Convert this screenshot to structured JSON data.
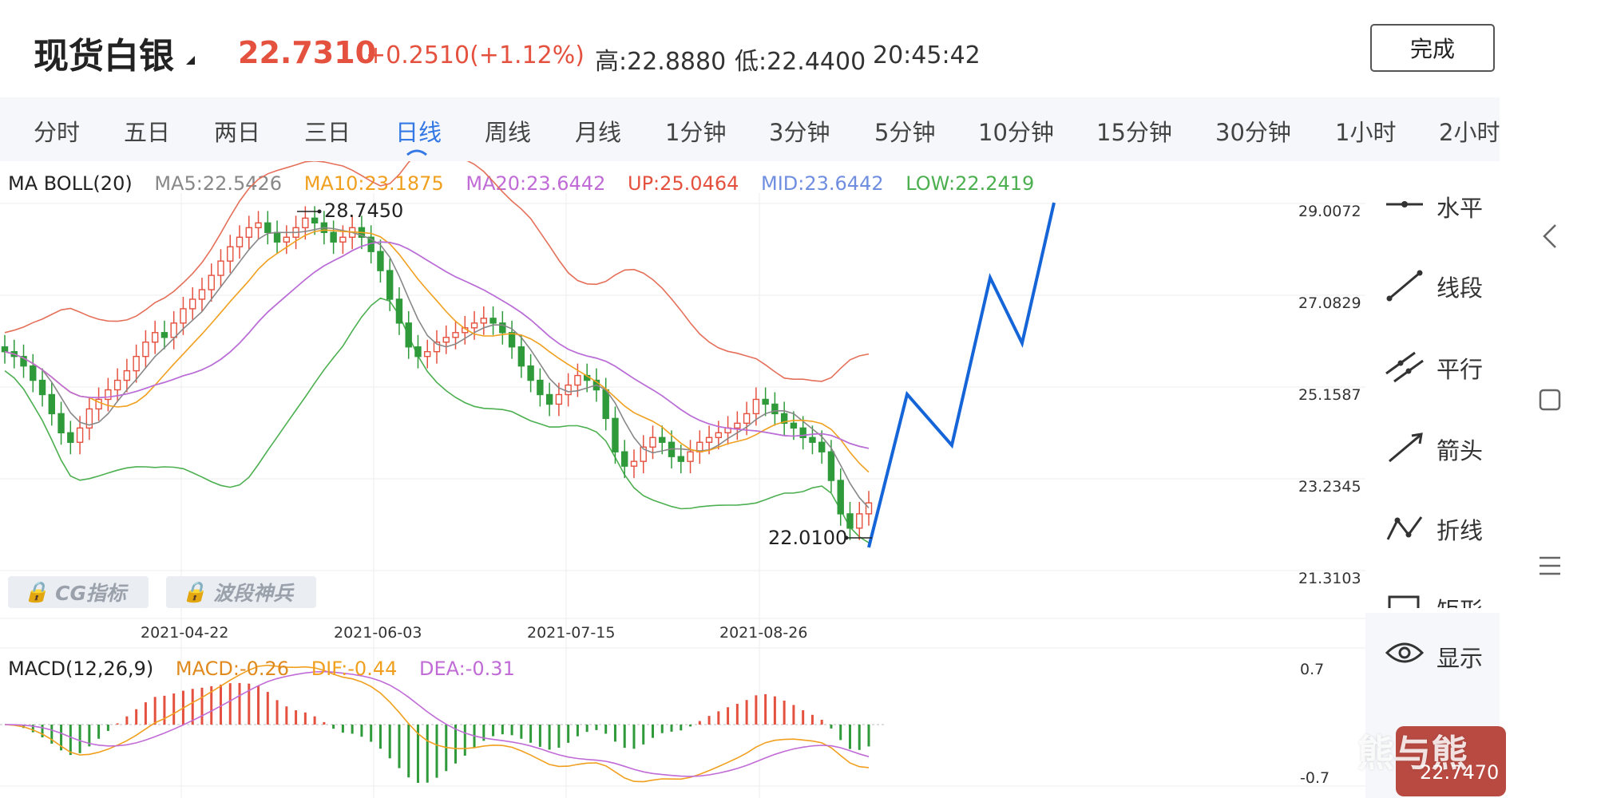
{
  "header": {
    "title": "现货白银",
    "price": "22.7310",
    "change": "+0.2510(+1.12%)",
    "high": "高:22.8880",
    "low": "低:22.4400",
    "time": "20:45:42",
    "done_label": "完成"
  },
  "tabs": [
    {
      "label": "分时"
    },
    {
      "label": "五日"
    },
    {
      "label": "两日"
    },
    {
      "label": "三日"
    },
    {
      "label": "日线",
      "active": true
    },
    {
      "label": "周线"
    },
    {
      "label": "月线"
    },
    {
      "label": "1分钟"
    },
    {
      "label": "3分钟"
    },
    {
      "label": "5分钟"
    },
    {
      "label": "10分钟"
    },
    {
      "label": "15分钟"
    },
    {
      "label": "30分钟"
    },
    {
      "label": "1小时"
    },
    {
      "label": "2小时"
    }
  ],
  "colors": {
    "up": "#e5513f",
    "down": "#2e9a3a",
    "ma5": "#888888",
    "ma10": "#f0a01e",
    "ma20": "#c06bd6",
    "boll_up": "#e5705a",
    "boll_mid": "#6f8ee0",
    "boll_low": "#4caf50",
    "accent": "#3478e5",
    "drawn_line": "#1565d8"
  },
  "main_legend": {
    "name": "MA BOLL(20)",
    "ma5": "MA5:22.5426",
    "ma10": "MA10:23.1875",
    "ma20": "MA20:23.6442",
    "up": "UP:25.0464",
    "mid": "MID:23.6442",
    "low": "LOW:22.2419"
  },
  "price_axis": [
    "29.0072",
    "27.0829",
    "25.1587",
    "23.2345",
    "21.3103"
  ],
  "max_label": "28.7450",
  "min_label": "22.0100",
  "indicator_buttons": [
    "CG指标",
    "波段神兵"
  ],
  "dates": [
    "2021-04-22",
    "2021-06-03",
    "2021-07-15",
    "2021-08-26"
  ],
  "macd_legend": {
    "name": "MACD(12,26,9)",
    "macd": "MACD:-0.26",
    "dif": "DIF:-0.44",
    "dea": "DEA:-0.31"
  },
  "macd_axis": [
    "0.7",
    "-0.7"
  ],
  "tools": [
    {
      "label": "水平",
      "icon": "horizontal-line-icon"
    },
    {
      "label": "线段",
      "icon": "segment-icon"
    },
    {
      "label": "平行",
      "icon": "parallel-lines-icon"
    },
    {
      "label": "箭头",
      "icon": "arrow-icon"
    },
    {
      "label": "折线",
      "icon": "polyline-icon"
    },
    {
      "label": "矩形",
      "icon": "rectangle-icon"
    }
  ],
  "display_label": "显示",
  "mini_quote": {
    "value": "22.7470"
  },
  "watermark": "熊与熊",
  "chart_data": {
    "type": "candlestick",
    "series_close": [
      25.9,
      25.8,
      25.6,
      25.3,
      25.0,
      24.6,
      24.2,
      24.0,
      24.3,
      24.7,
      24.9,
      25.1,
      25.3,
      25.5,
      25.8,
      26.1,
      26.3,
      26.2,
      26.5,
      26.8,
      27.0,
      27.2,
      27.5,
      27.8,
      28.1,
      28.3,
      28.5,
      28.6,
      28.4,
      28.2,
      28.3,
      28.5,
      28.7,
      28.6,
      28.4,
      28.2,
      28.3,
      28.5,
      28.3,
      28.0,
      27.6,
      27.0,
      26.5,
      26.0,
      25.8,
      25.9,
      26.1,
      26.2,
      26.3,
      26.4,
      26.5,
      26.6,
      26.5,
      26.3,
      26.0,
      25.6,
      25.3,
      25.0,
      24.8,
      25.0,
      25.2,
      25.4,
      25.3,
      25.1,
      24.5,
      23.8,
      23.5,
      23.6,
      23.9,
      24.1,
      24.0,
      23.7,
      23.6,
      23.8,
      24.0,
      24.1,
      24.2,
      24.3,
      24.4,
      24.6,
      24.9,
      24.8,
      24.6,
      24.4,
      24.3,
      24.1,
      24.0,
      23.8,
      23.2,
      22.5,
      22.2,
      22.5,
      22.73
    ],
    "macd_ylim": [
      -0.7,
      0.7
    ],
    "price_ylim": [
      21.3103,
      29.0072
    ]
  }
}
